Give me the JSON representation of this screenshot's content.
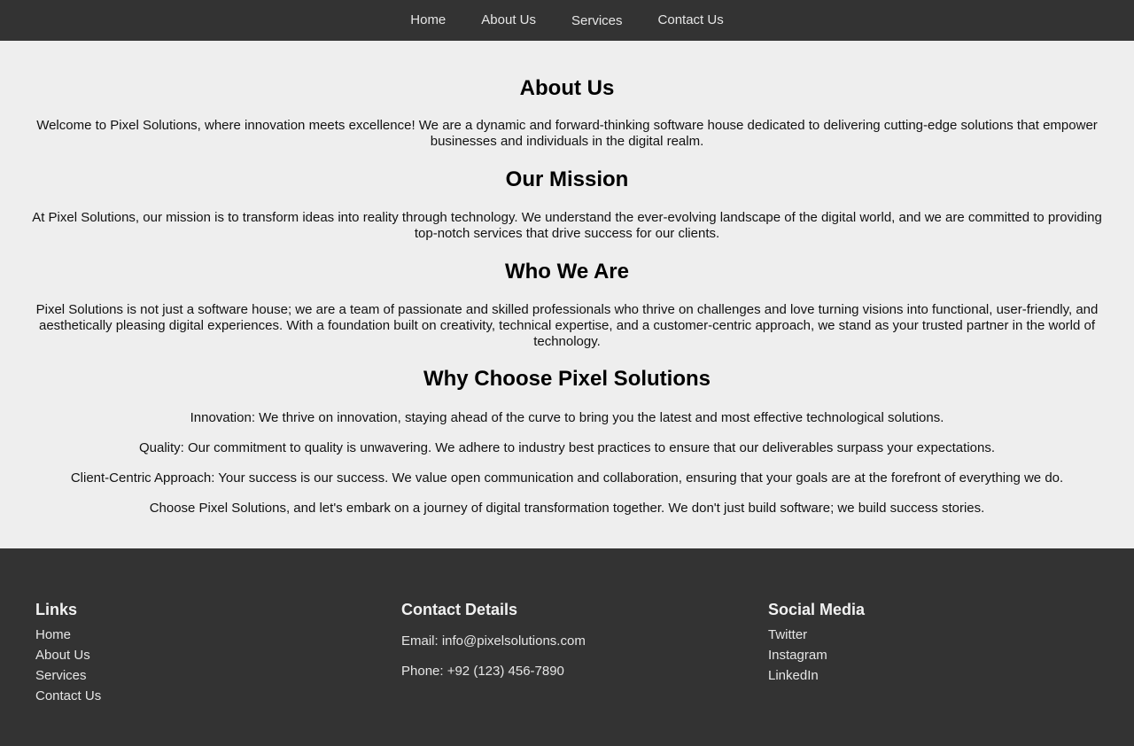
{
  "nav": {
    "items": [
      {
        "label": "Home"
      },
      {
        "label": "About Us"
      },
      {
        "label": "Services"
      },
      {
        "label": "Contact Us"
      }
    ]
  },
  "main": {
    "about_title": "About Us",
    "about_text": "Welcome to Pixel Solutions, where innovation meets excellence! We are a dynamic and forward-thinking software house dedicated to delivering cutting-edge solutions that empower businesses and individuals in the digital realm.",
    "mission_title": "Our Mission",
    "mission_text": "At Pixel Solutions, our mission is to transform ideas into reality through technology. We understand the ever-evolving landscape of the digital world, and we are committed to providing top-notch services that drive success for our clients.",
    "who_title": "Who We Are",
    "who_text": "Pixel Solutions is not just a software house; we are a team of passionate and skilled professionals who thrive on challenges and love turning visions into functional, user-friendly, and aesthetically pleasing digital experiences. With a foundation built on creativity, technical expertise, and a customer-centric approach, we stand as your trusted partner in the world of technology.",
    "why_title": "Why Choose Pixel Solutions",
    "why_points": [
      "Innovation: We thrive on innovation, staying ahead of the curve to bring you the latest and most effective technological solutions.",
      "Quality: Our commitment to quality is unwavering. We adhere to industry best practices to ensure that our deliverables surpass your expectations.",
      "Client-Centric Approach: Your success is our success. We value open communication and collaboration, ensuring that your goals are at the forefront of everything we do.",
      "Choose Pixel Solutions, and let's embark on a journey of digital transformation together. We don't just build software; we build success stories."
    ]
  },
  "footer": {
    "links": {
      "title": "Links",
      "items": [
        "Home",
        "About Us",
        "Services",
        "Contact Us"
      ]
    },
    "contact": {
      "title": "Contact Details",
      "email": "Email: info@pixelsolutions.com",
      "phone": "Phone: +92 (123) 456-7890"
    },
    "social": {
      "title": "Social Media",
      "items": [
        "Twitter",
        "Instagram",
        "LinkedIn"
      ]
    }
  },
  "colors": {
    "nav_background": "#333333",
    "page_background": "#eeeeee",
    "footer_background": "#333333"
  }
}
